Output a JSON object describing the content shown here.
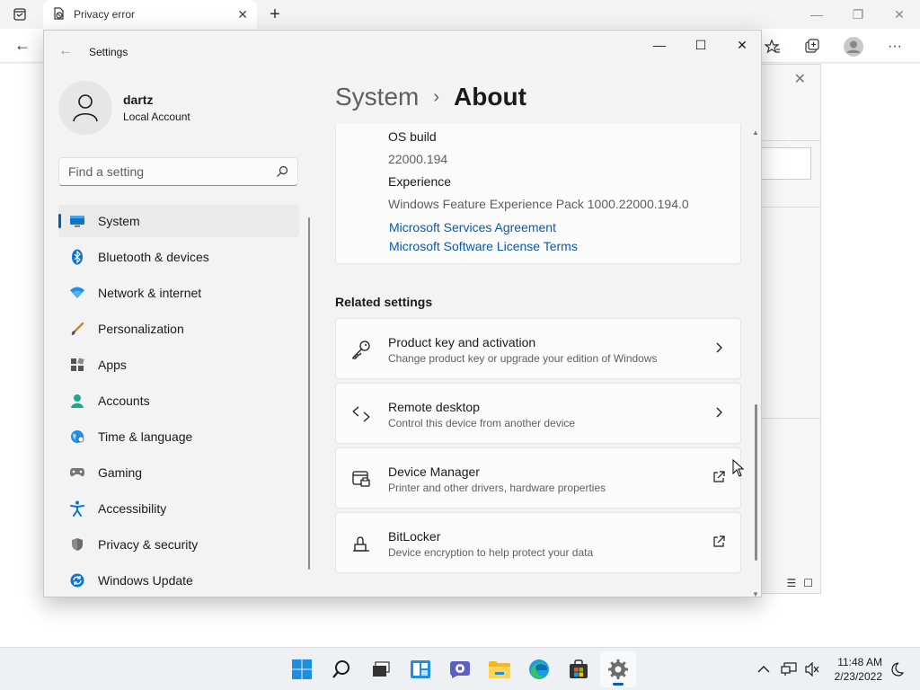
{
  "browser": {
    "tab_title": "Privacy error",
    "tab_close": "✕",
    "new_tab": "+",
    "back": "←",
    "minimize": "—",
    "restore": "❐",
    "close": "✕",
    "toolbar_more": "···"
  },
  "settings": {
    "app_title": "Settings",
    "back": "←",
    "minimize": "—",
    "maximize": "☐",
    "close": "✕",
    "profile": {
      "name": "dartz",
      "account_type": "Local Account"
    },
    "search": {
      "placeholder": "Find a setting"
    },
    "nav": [
      {
        "label": "System",
        "icon": "system-icon",
        "selected": true
      },
      {
        "label": "Bluetooth & devices",
        "icon": "bluetooth-icon"
      },
      {
        "label": "Network & internet",
        "icon": "wifi-icon"
      },
      {
        "label": "Personalization",
        "icon": "brush-icon"
      },
      {
        "label": "Apps",
        "icon": "apps-icon"
      },
      {
        "label": "Accounts",
        "icon": "accounts-icon"
      },
      {
        "label": "Time & language",
        "icon": "globe-icon"
      },
      {
        "label": "Gaming",
        "icon": "gamepad-icon"
      },
      {
        "label": "Accessibility",
        "icon": "accessibility-icon"
      },
      {
        "label": "Privacy & security",
        "icon": "shield-icon"
      },
      {
        "label": "Windows Update",
        "icon": "update-icon"
      }
    ],
    "breadcrumb": {
      "parent": "System",
      "separator": "›",
      "current": "About"
    },
    "specs": {
      "os_build_label": "OS build",
      "os_build_value": "22000.194",
      "experience_label": "Experience",
      "experience_value": "Windows Feature Experience Pack 1000.22000.194.0",
      "link_services": "Microsoft Services Agreement",
      "link_license": "Microsoft Software License Terms"
    },
    "related": {
      "title": "Related settings",
      "items": [
        {
          "title": "Product key and activation",
          "desc": "Change product key or upgrade your edition of Windows",
          "icon": "key-icon",
          "action": "chevron"
        },
        {
          "title": "Remote desktop",
          "desc": "Control this device from another device",
          "icon": "remote-desktop-icon",
          "action": "chevron"
        },
        {
          "title": "Device Manager",
          "desc": "Printer and other drivers, hardware properties",
          "icon": "device-manager-icon",
          "action": "external"
        },
        {
          "title": "BitLocker",
          "desc": "Device encryption to help protect your data",
          "icon": "lock-icon",
          "action": "external"
        }
      ]
    }
  },
  "taskbar": {
    "apps": [
      "start",
      "search",
      "task-view",
      "widgets",
      "chat",
      "file-explorer",
      "edge",
      "store",
      "settings"
    ],
    "time": "11:48 AM",
    "date": "2/23/2022"
  },
  "colors": {
    "accent": "#005fb8",
    "link": "#0a5aa8"
  }
}
